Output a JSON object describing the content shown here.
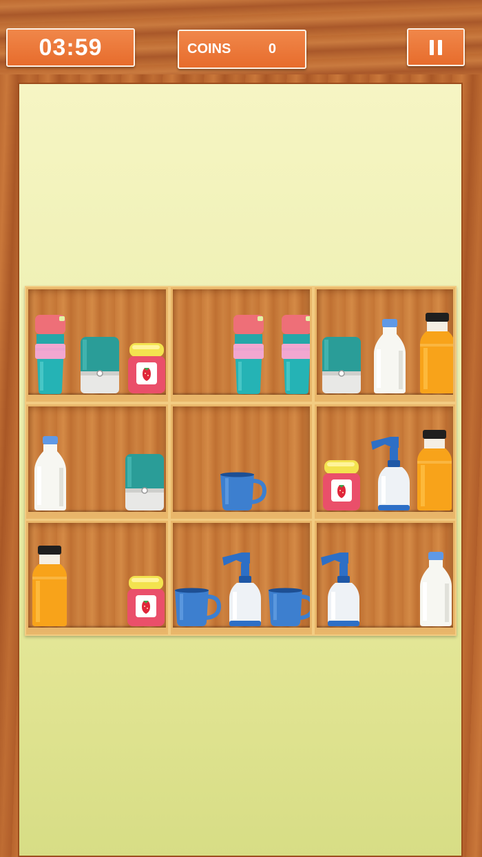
{
  "hud": {
    "timer": "03:59",
    "coins_label": "COINS",
    "coins_value": "0",
    "pause_icon": "pause-icon"
  },
  "colors": {
    "hud_orange": "#e97a3a",
    "board_yellow": "#eef0b2",
    "shelf_wood": "#c97c3b"
  },
  "shelves": [
    {
      "items": [
        "thermos-cup",
        "teal-tin-can",
        "strawberry-jam-jar"
      ]
    },
    {
      "items": [
        "thermos-cup",
        "thermos-cup"
      ]
    },
    {
      "items": [
        "teal-tin-can",
        "milk-bottle",
        "orange-juice-bottle"
      ]
    },
    {
      "items": [
        "milk-bottle",
        "teal-tin-can"
      ]
    },
    {
      "items": [
        "blue-mug"
      ]
    },
    {
      "items": [
        "strawberry-jam-jar",
        "spray-bottle",
        "orange-juice-bottle"
      ]
    },
    {
      "items": [
        "orange-juice-bottle",
        "strawberry-jam-jar"
      ]
    },
    {
      "items": [
        "blue-mug",
        "spray-bottle",
        "blue-mug"
      ]
    },
    {
      "items": [
        "spray-bottle",
        "milk-bottle"
      ]
    }
  ]
}
